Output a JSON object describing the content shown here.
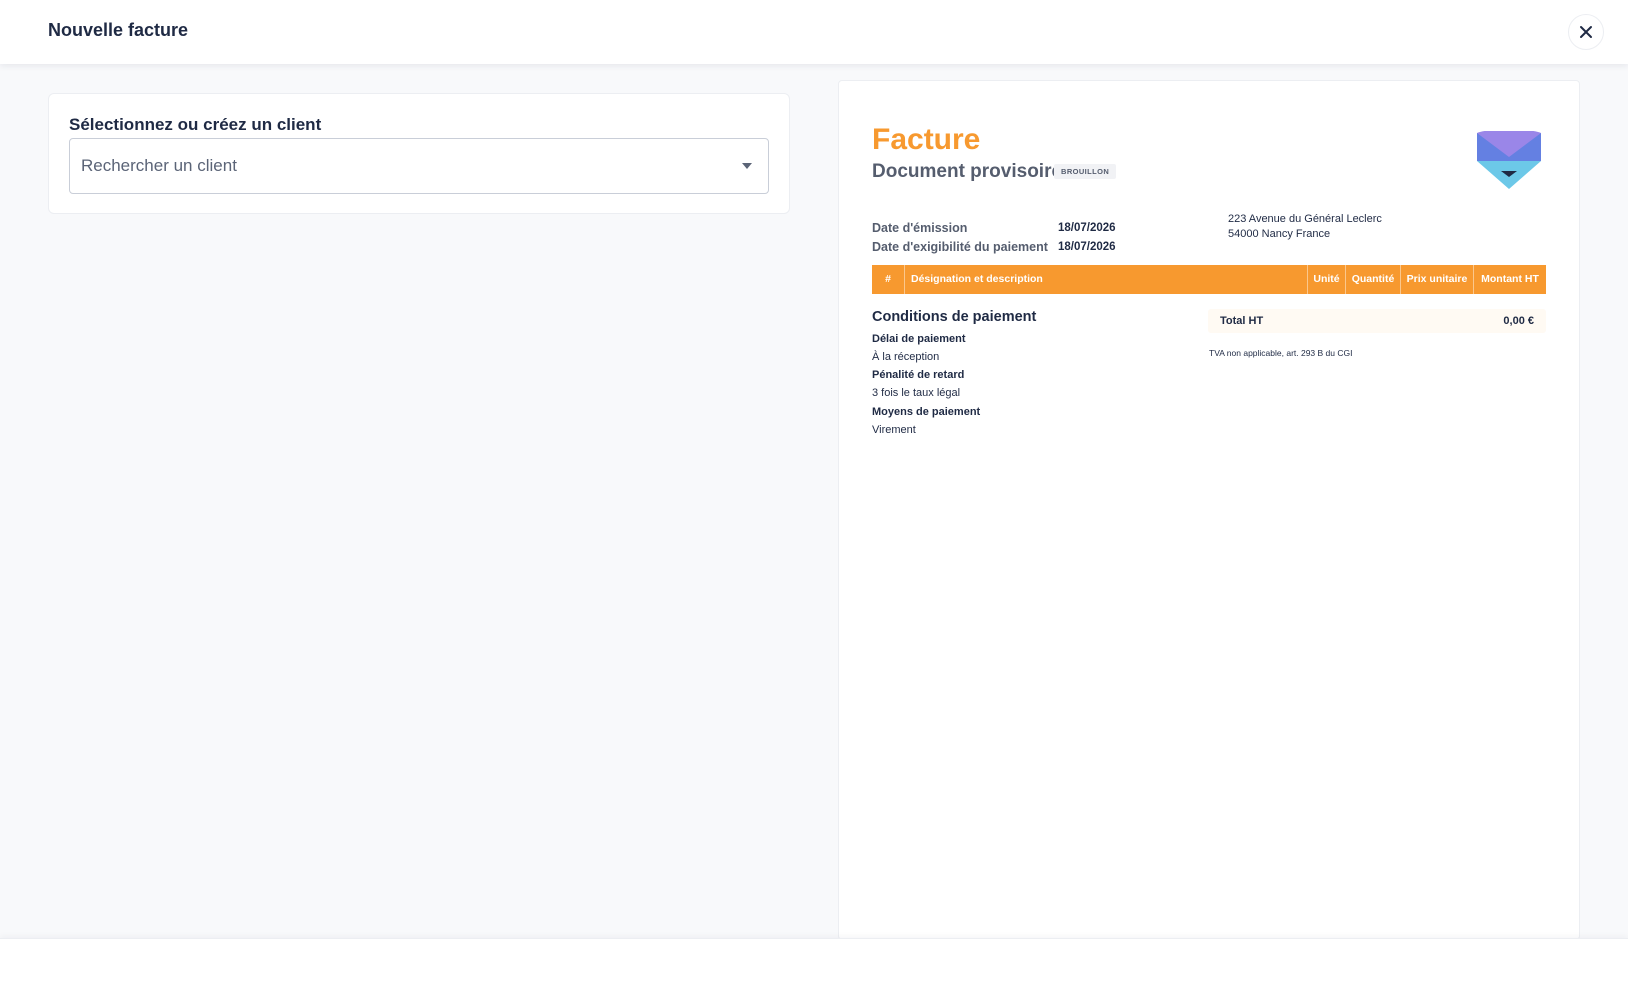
{
  "header": {
    "title": "Nouvelle facture",
    "close_icon": "close-icon"
  },
  "client": {
    "label": "Sélectionnez ou créez un client",
    "search_value": "",
    "search_placeholder": "Rechercher un client",
    "caret_icon": "caret-down-icon"
  },
  "invoice": {
    "title": "Facture",
    "subtitle": "Document provisoire",
    "status_badge": "BROUILLON",
    "accent_color": "#f7992f",
    "issue_date_label": "Date d'émission",
    "issue_date_value": "18/07/2026",
    "due_date_label": "Date d'exigibilité du paiement",
    "due_date_value": "18/07/2026",
    "address_lines": [
      "223 Avenue du Général Leclerc",
      "54000 Nancy France"
    ],
    "table_headers": {
      "num": "#",
      "designation": "Désignation et description",
      "unit": "Unité",
      "quantity": "Quantité",
      "unit_price": "Prix unitaire",
      "amount": "Montant HT"
    },
    "conditions": {
      "title": "Conditions de paiement",
      "items": [
        {
          "label": "Délai de paiement",
          "value": "À la réception"
        },
        {
          "label": "Pénalité de retard",
          "value": "3 fois le taux légal"
        },
        {
          "label": "Moyens de paiement",
          "value": "Virement"
        }
      ]
    },
    "totals": {
      "total_ht_label": "Total HT",
      "total_ht_value": "0,00 €",
      "tva_note": "TVA non applicable, art. 293 B du CGI"
    }
  }
}
